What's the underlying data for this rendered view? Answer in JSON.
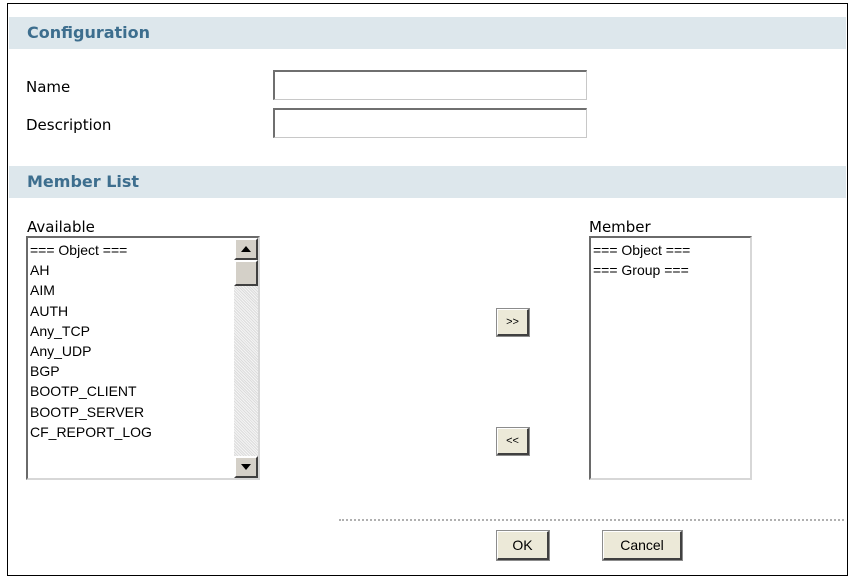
{
  "configuration": {
    "header": "Configuration",
    "name_label": "Name",
    "name_value": "",
    "description_label": "Description",
    "description_value": ""
  },
  "member_list": {
    "header": "Member List",
    "available_label": "Available",
    "member_label": "Member",
    "available_items": [
      "=== Object ===",
      "AH",
      "AIM",
      "AUTH",
      "Any_TCP",
      "Any_UDP",
      "BGP",
      "BOOTP_CLIENT",
      "BOOTP_SERVER",
      "CF_REPORT_LOG"
    ],
    "member_items": [
      "=== Object ===",
      "=== Group ==="
    ],
    "add_button": ">>",
    "remove_button": "<<"
  },
  "footer": {
    "ok_button": "OK",
    "cancel_button": "Cancel"
  },
  "colors": {
    "header_background": "#dde7ec",
    "header_text": "#3d6e8e"
  }
}
